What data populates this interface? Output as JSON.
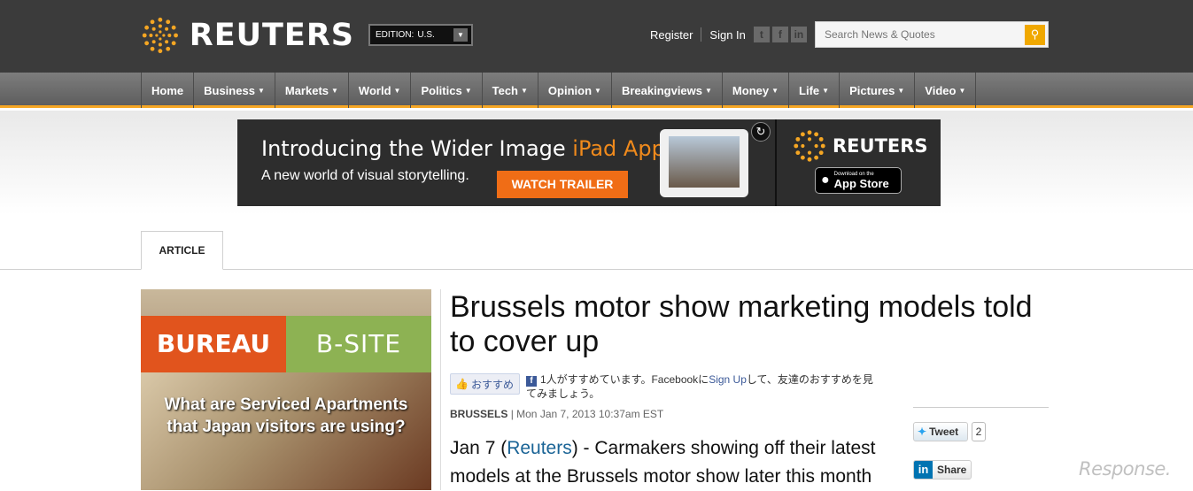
{
  "header": {
    "logo_text": "REUTERS",
    "edition_label": "EDITION:",
    "edition_value": "U.S.",
    "register": "Register",
    "sign_in": "Sign In",
    "search_placeholder": "Search News & Quotes",
    "social_icons": [
      "twitter-icon",
      "facebook-icon",
      "linkedin-icon"
    ]
  },
  "nav": {
    "items": [
      {
        "label": "Home",
        "dropdown": false
      },
      {
        "label": "Business",
        "dropdown": true
      },
      {
        "label": "Markets",
        "dropdown": true
      },
      {
        "label": "World",
        "dropdown": true
      },
      {
        "label": "Politics",
        "dropdown": true
      },
      {
        "label": "Tech",
        "dropdown": true
      },
      {
        "label": "Opinion",
        "dropdown": true
      },
      {
        "label": "Breakingviews",
        "dropdown": true
      },
      {
        "label": "Money",
        "dropdown": true
      },
      {
        "label": "Life",
        "dropdown": true
      },
      {
        "label": "Pictures",
        "dropdown": true
      },
      {
        "label": "Video",
        "dropdown": true
      }
    ]
  },
  "banner": {
    "line1_prefix": "Introducing the Wider Image ",
    "line1_highlight": "iPad App.",
    "line2": "A new world of visual storytelling.",
    "button": "WATCH TRAILER",
    "brand": "REUTERS",
    "appstore_small": "Download on the",
    "appstore_big": "App Store"
  },
  "tabs": {
    "article": "ARTICLE"
  },
  "ad": {
    "left_tag": "BUREAU",
    "right_tag": "B-SITE",
    "text_line1": "What are Serviced Apartments",
    "text_line2": "that Japan visitors are using?"
  },
  "article": {
    "headline": "Brussels motor show marketing models told to cover up",
    "like_label": "おすすめ",
    "fb_text_1": "1人がすすめています。Facebookに",
    "fb_link": "Sign Up",
    "fb_text_2": "して、友達のおすすめを見てみましょう。",
    "location": "BRUSSELS",
    "dateline": "| Mon Jan 7, 2013 10:37am EST",
    "body_prefix": "Jan 7 (",
    "body_link": "Reuters",
    "body_rest": ") - Carmakers showing off their latest models at the Brussels motor show later this month"
  },
  "share": {
    "tweet": "Tweet",
    "tweet_count": "2",
    "linkedin": "Share"
  },
  "watermark": "Response."
}
